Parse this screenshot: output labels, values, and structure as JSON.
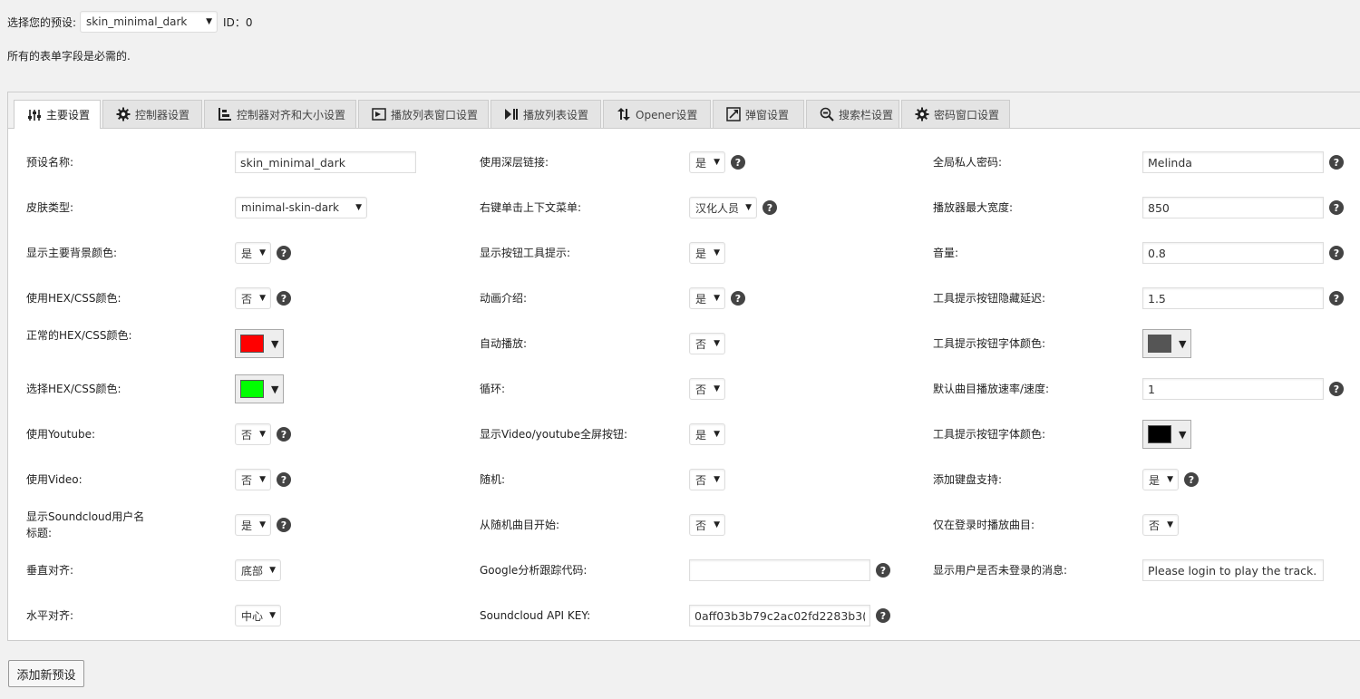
{
  "header": {
    "preset_label": "选择您的预设:",
    "preset_value": "skin_minimal_dark",
    "id_text": "ID：0",
    "required_note": "所有的表单字段是必需的."
  },
  "tabs": [
    {
      "label": "主要设置",
      "icon": "sliders-icon",
      "active": true
    },
    {
      "label": "控制器设置",
      "icon": "gear-icon"
    },
    {
      "label": "控制器对齐和大小设置",
      "icon": "align-bars-icon"
    },
    {
      "label": "播放列表窗口设置",
      "icon": "playlist-window-icon"
    },
    {
      "label": "播放列表设置",
      "icon": "playlist-icon"
    },
    {
      "label": "Opener设置",
      "icon": "up-down-arrows-icon"
    },
    {
      "label": "弹窗设置",
      "icon": "popup-icon"
    },
    {
      "label": "搜索栏设置",
      "icon": "search-bar-icon"
    },
    {
      "label": "密码窗口设置",
      "icon": "password-gear-icon"
    }
  ],
  "col1": [
    {
      "label": "预设名称:",
      "type": "text",
      "value": "skin_minimal_dark"
    },
    {
      "label": "皮肤类型:",
      "type": "select",
      "value": "minimal-skin-dark"
    },
    {
      "label": "显示主要背景颜色:",
      "type": "select",
      "value": "是",
      "help": true
    },
    {
      "label": "使用HEX/CSS颜色:",
      "type": "select",
      "value": "否",
      "help": true
    },
    {
      "label": "正常的HEX/CSS颜色:",
      "type": "color",
      "color": "#ff0000"
    },
    {
      "label": "选择HEX/CSS颜色:",
      "type": "color",
      "color": "#00ff00"
    },
    {
      "label": "使用Youtube:",
      "type": "select",
      "value": "否",
      "help": true
    },
    {
      "label": "使用Video:",
      "type": "select",
      "value": "否",
      "help": true
    },
    {
      "label": "显示Soundcloud用户名标题:",
      "type": "select",
      "value": "是",
      "help": true
    },
    {
      "label": "垂直对齐:",
      "type": "select",
      "value": "底部"
    },
    {
      "label": "水平对齐:",
      "type": "select",
      "value": "中心"
    }
  ],
  "col2": [
    {
      "label": "使用深层链接:",
      "type": "select",
      "value": "是",
      "help": true
    },
    {
      "label": "右键单击上下文菜单:",
      "type": "select",
      "value": "汉化人员",
      "help": true
    },
    {
      "label": "显示按钮工具提示:",
      "type": "select",
      "value": "是"
    },
    {
      "label": "动画介绍:",
      "type": "select",
      "value": "是",
      "help": true
    },
    {
      "label": "自动播放:",
      "type": "select",
      "value": "否"
    },
    {
      "label": "循环:",
      "type": "select",
      "value": "否"
    },
    {
      "label": "显示Video/youtube全屏按钮:",
      "type": "select",
      "value": "是"
    },
    {
      "label": "随机:",
      "type": "select",
      "value": "否"
    },
    {
      "label": "从随机曲目开始:",
      "type": "select",
      "value": "否"
    },
    {
      "label": "Google分析跟踪代码:",
      "type": "text",
      "value": "",
      "help": true
    },
    {
      "label": "Soundcloud API KEY:",
      "type": "text",
      "value": "0aff03b3b79c2ac02fd2283b3(",
      "help": true
    }
  ],
  "col3": [
    {
      "label": "全局私人密码:",
      "type": "text",
      "value": "Melinda",
      "help": true
    },
    {
      "label": "播放器最大宽度:",
      "type": "text",
      "value": "850",
      "help": true
    },
    {
      "label": "音量:",
      "type": "text",
      "value": "0.8",
      "help": true
    },
    {
      "label": "工具提示按钮隐藏延迟:",
      "type": "text",
      "value": "1.5",
      "help": true
    },
    {
      "label": "工具提示按钮字体颜色:",
      "type": "color",
      "color": "#555555"
    },
    {
      "label": "默认曲目播放速率/速度:",
      "type": "text",
      "value": "1",
      "help": true
    },
    {
      "label": "工具提示按钮字体颜色:",
      "type": "color",
      "color": "#000000"
    },
    {
      "label": "添加键盘支持:",
      "type": "select",
      "value": "是",
      "help": true
    },
    {
      "label": "仅在登录时播放曲目:",
      "type": "select",
      "value": "否"
    },
    {
      "label": "显示用户是否未登录的消息:",
      "type": "text",
      "value": "Please login to play the track."
    }
  ],
  "footer": {
    "add_button": "添加新预设"
  }
}
